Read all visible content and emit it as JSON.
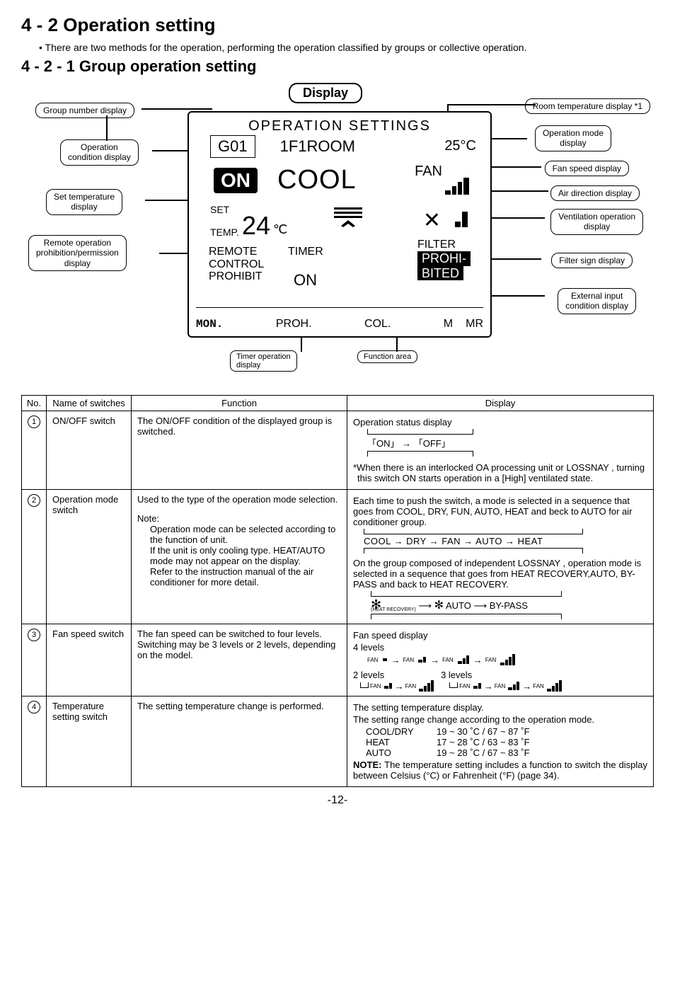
{
  "heading": "4 - 2  Operation setting",
  "bullet": "• There are two methods for the operation, performing the operation classified by groups or collective operation.",
  "subheading": "4 - 2 - 1  Group operation setting",
  "diagram": {
    "display_pill": "Display",
    "callouts": {
      "group_number": "Group number display",
      "operation_condition": "Operation\ncondition display",
      "set_temperature": "Set temperature\ndisplay",
      "remote_operation": "Remote operation\nprohibition/permission\ndisplay",
      "room_temp": "Room temperature display *1",
      "operation_mode": "Operation mode\ndisplay",
      "fan_speed": "Fan speed display",
      "air_direction": "Air direction display",
      "ventilation": "Ventilation operation\ndisplay",
      "filter_sign": "Filter sign display",
      "external_input": "External input\ncondition display",
      "timer_operation": "Timer operation\ndisplay",
      "function_area": "Function area"
    },
    "lcd": {
      "title": "OPERATION  SETTINGS",
      "group": "G01",
      "room": "1F1ROOM",
      "room_temp": "25°C",
      "on": "ON",
      "mode": "COOL",
      "fan_label": "FAN",
      "set_label1": "SET",
      "set_label2": "TEMP.",
      "set_value": "24",
      "set_unit": "℃",
      "remote1": "REMOTE",
      "remote2": "CONTROL",
      "remote3": "PROHIBIT",
      "timer": "TIMER",
      "timer_on": "ON",
      "filter": "FILTER",
      "prohi1": "PROHI-",
      "prohi2": "BITED",
      "mon": "MON.",
      "proh": "PROH.",
      "col": "COL.",
      "m": "M",
      "mr": "MR"
    }
  },
  "table": {
    "headers": {
      "no": "No.",
      "name": "Name of switches",
      "function": "Function",
      "display": "Display"
    },
    "rows": [
      {
        "no": "1",
        "name": "ON/OFF switch",
        "function": "The ON/OFF condition of the displayed group is switched.",
        "display": {
          "line1": "Operation status display",
          "flow": "「ON」 → 「OFF」",
          "note": "*When there is an interlocked OA processing unit or LOSSNAY , turning this switch ON starts operation in a [High] ventilated state."
        }
      },
      {
        "no": "2",
        "name": "Operation mode switch",
        "function_parts": {
          "p1": "Used to the type of the operation mode selection.",
          "note_label": "Note:",
          "p2": "Operation mode can be selected according to the function of unit.\nIf the unit is only cooling type. HEAT/AUTO mode may not appear on the display.\nRefer to the instruction manual of the air conditioner for more detail."
        },
        "display": {
          "p1": "Each time to push the switch, a mode is selected in a sequence that goes from COOL, DRY, FUN, AUTO, HEAT and beck to AUTO for air conditioner group.",
          "flow1": "COOL → DRY → FAN → AUTO → HEAT",
          "p2": "On the group composed of independent LOSSNAY , operation mode is selected in a sequence that goes from HEAT RECOVERY,AUTO, BY-PASS and back to HEAT RECOVERY.",
          "flow2_auto": "AUTO",
          "flow2_bypass": "BY-PASS",
          "heat_recovery_label": "(HEAT RECOVERY)"
        }
      },
      {
        "no": "3",
        "name": "Fan speed switch",
        "function": "The fan speed can be switched to four levels. Switching may be 3 levels or 2 levels, depending on the model.",
        "display": {
          "title": "Fan speed display",
          "levels4": "4 levels",
          "levels2": "2 levels",
          "levels3": "3 levels",
          "fan_label": "FAN"
        }
      },
      {
        "no": "4",
        "name": "Temperature setting switch",
        "function": "The setting temperature change is performed.",
        "display": {
          "p1": "The setting temperature display.",
          "p2": "The setting range change according to the operation mode.",
          "ranges": {
            "cooldry_label": "COOL/DRY",
            "cooldry_val": "19 ~ 30 ˚C / 67 ~ 87 ˚F",
            "heat_label": "HEAT",
            "heat_val": "17 ~ 28 ˚C / 63 ~ 83 ˚F",
            "auto_label": "AUTO",
            "auto_val": "19 ~ 28 ˚C / 67 ~ 83 ˚F"
          },
          "note_label": "NOTE:",
          "note": "The temperature setting includes a function to switch the display between Celsius (°C) or Fahrenheit (°F) (page 34)."
        }
      }
    ]
  },
  "page_number": "-12-"
}
